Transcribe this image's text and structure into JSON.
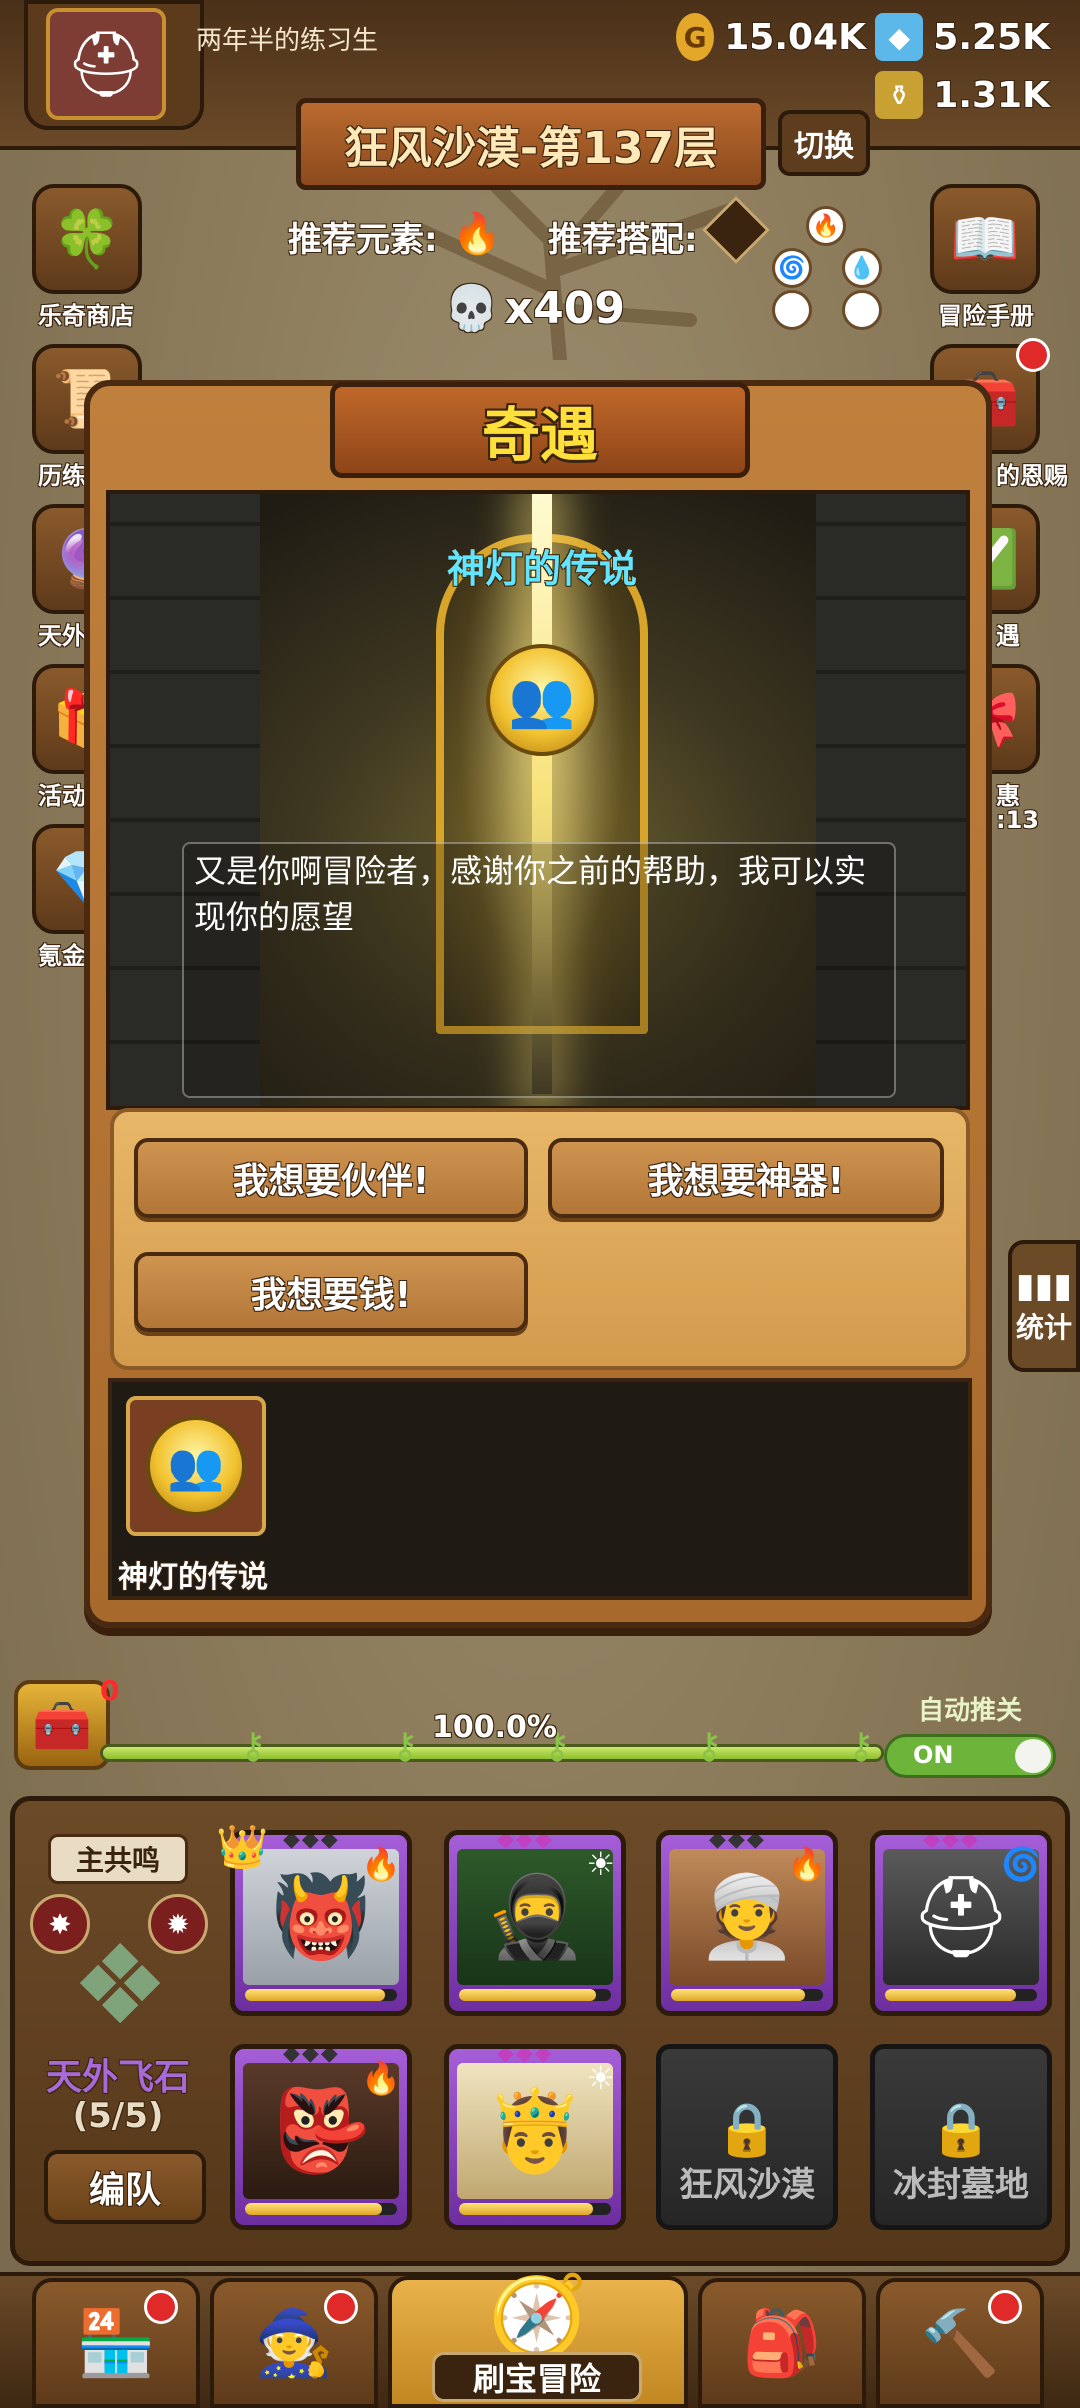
{
  "top": {
    "player_name": "两年半的练习生",
    "gold": "15.04K",
    "diamonds": "5.25K",
    "potions": "1.31K"
  },
  "stage": {
    "title": "狂风沙漠-第137层",
    "switch_label": "切换",
    "recommend_element_label": "推荐元素:",
    "recommend_combo_label": "推荐搭配:",
    "skull_count": "x409"
  },
  "left_menu": [
    {
      "label": "乐奇商店",
      "icon": "clover-icon"
    },
    {
      "label": "历练",
      "icon": "scroll-icon"
    },
    {
      "label": "天外",
      "icon": "orb-icon"
    },
    {
      "label": "活动",
      "icon": "gift-icon"
    },
    {
      "label": "氪金",
      "icon": "diamond-icon"
    }
  ],
  "right_menu": [
    {
      "label": "冒险手册",
      "icon": "book-icon"
    },
    {
      "label": "的恩赐",
      "icon": "chest-icon"
    },
    {
      "label": "遇",
      "icon": "check-icon"
    },
    {
      "label": "惠",
      "icon": "treasure-icon"
    }
  ],
  "right_menu_timer": ":13",
  "dialog": {
    "title": "奇遇",
    "event_name": "神灯的传说",
    "message": "又是你啊冒险者，感谢你之前的帮助，我可以实现你的愿望",
    "options": [
      "我想要伙伴!",
      "我想要神器!",
      "我想要钱!"
    ],
    "item_label": "神灯的传说"
  },
  "stats_label": "统计",
  "progress": {
    "chest_count": "0",
    "percent_text": "100.0%",
    "percent_value": 100,
    "auto_label": "自动推关",
    "toggle_text": "ON"
  },
  "team": {
    "leader_tag": "主共鸣",
    "name": "天外飞石",
    "count": "(5/5)",
    "formation_label": "编队",
    "heroes": [
      {
        "icon": "demon-hero-icon",
        "element": "fire-icon"
      },
      {
        "icon": "hooded-hero-icon",
        "element": "light-icon"
      },
      {
        "icon": "turban-hero-icon",
        "element": "fire-icon"
      },
      {
        "icon": "knight-hero-icon",
        "element": "wind-icon"
      },
      {
        "icon": "masked-hero-icon",
        "element": "fire-icon"
      },
      {
        "icon": "king-hero-icon",
        "element": "light-icon"
      }
    ],
    "locked": [
      "狂风沙漠",
      "冰封墓地"
    ]
  },
  "bottom_nav": {
    "center_label": "刷宝冒险"
  },
  "colors": {
    "accent_gold": "#ffdf3a",
    "event_name": "#62e6ff",
    "team_name": "#a86ad8"
  }
}
